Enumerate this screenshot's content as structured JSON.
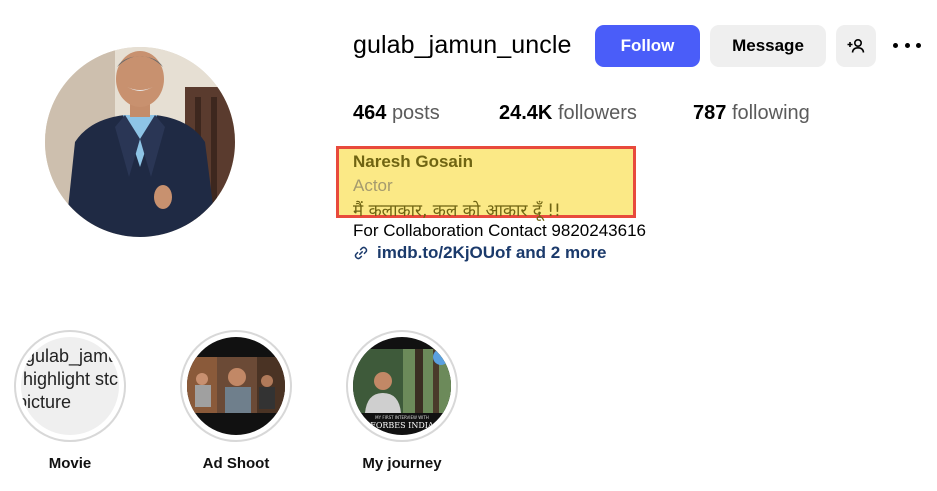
{
  "profile": {
    "username": "gulab_jamun_uncle",
    "follow_label": "Follow",
    "message_label": "Message",
    "stats": {
      "posts_count": "464",
      "posts_label": "posts",
      "followers_count": "24.4K",
      "followers_label": "followers",
      "following_count": "787",
      "following_label": "following"
    },
    "bio": {
      "name": "Naresh Gosain",
      "category": "Actor",
      "tagline": "मैं कलाकार, कल को आकार दूँ !!",
      "contact": "For Collaboration Contact 9820243616",
      "link": "imdb.to/2KjOUof and 2 more"
    }
  },
  "highlights": [
    {
      "label": "Movie",
      "broken_alt": [
        "gulab_jamu",
        "highlight stc",
        "picture"
      ]
    },
    {
      "label": "Ad Shoot"
    },
    {
      "label": "My journey",
      "thumb_text": [
        "MY FIRST INTERVIEW WITH",
        "FORBES INDIA"
      ]
    }
  ],
  "colors": {
    "follow_button": "#4a5df9",
    "secondary_button": "#efefef",
    "annotation_fill": "#fbe986",
    "annotation_border": "#e84a3c"
  },
  "icons": {
    "add_user": "add-user-icon",
    "more": "more-options-icon",
    "link": "link-icon"
  }
}
